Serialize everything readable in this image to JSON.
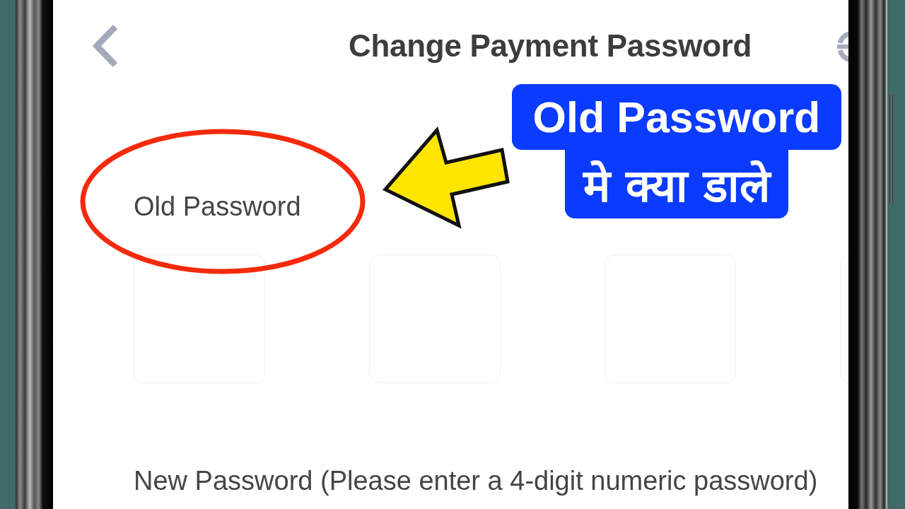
{
  "header": {
    "title": "Change Payment Password"
  },
  "old_password": {
    "label": "Old Password",
    "digits": [
      {
        "filled": false
      },
      {
        "filled": false
      },
      {
        "filled": false
      },
      {
        "filled": false
      }
    ]
  },
  "new_password": {
    "label": "New Password (Please enter a 4-digit numeric password)"
  },
  "callout": {
    "lines": [
      "Old Password",
      "मे क्या डाले"
    ]
  }
}
